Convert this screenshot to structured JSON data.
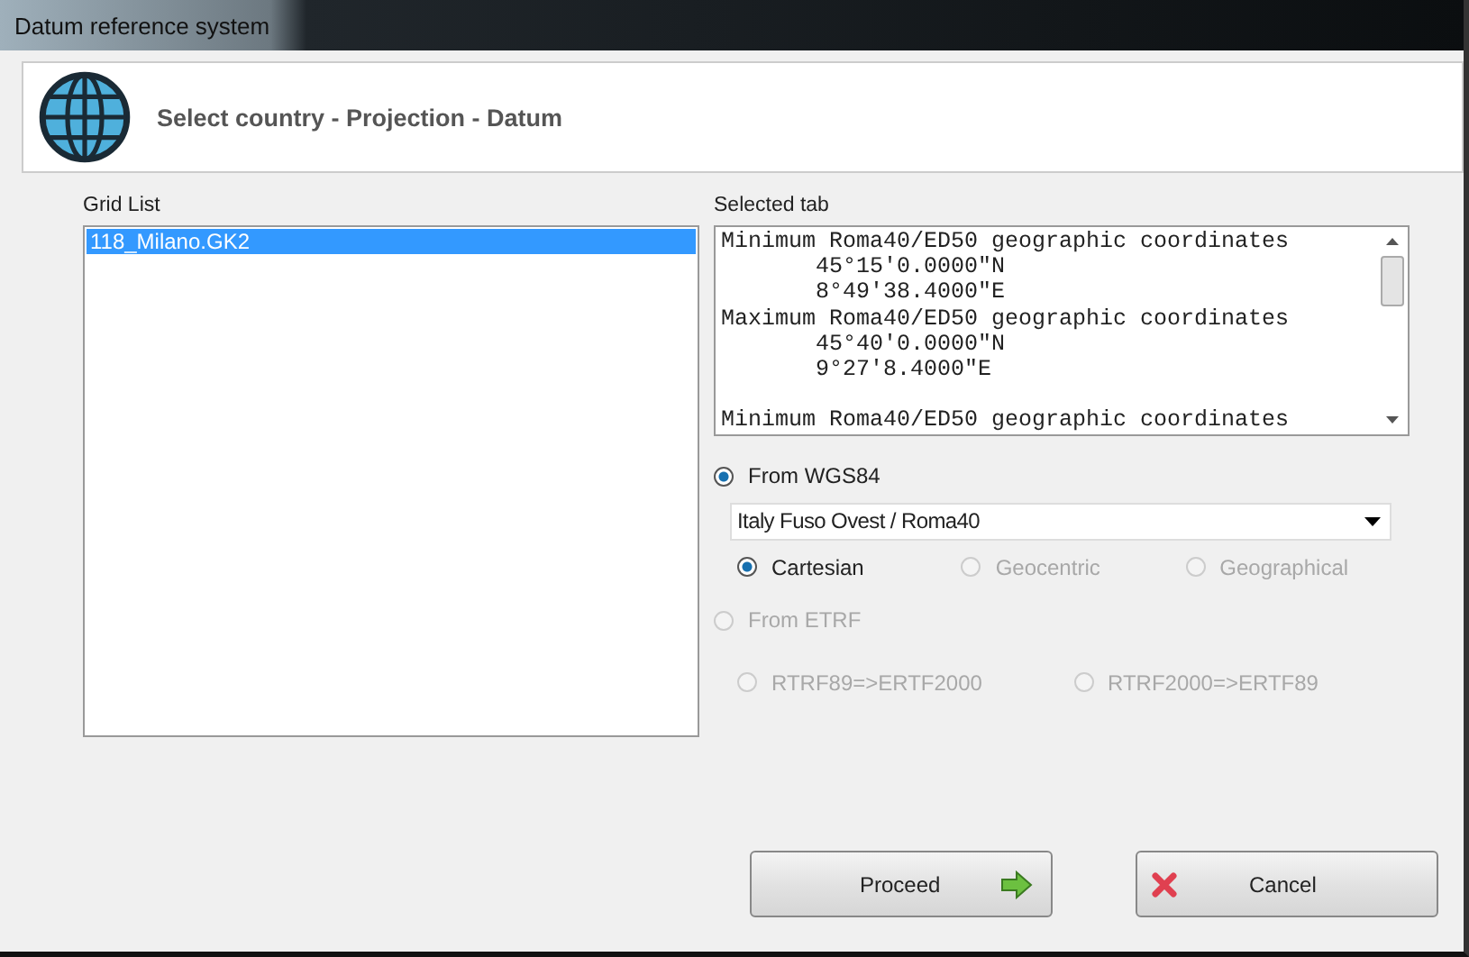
{
  "window": {
    "title": "Datum reference system"
  },
  "header": {
    "title": "Select country - Projection - Datum"
  },
  "grid_list": {
    "label": "Grid List",
    "items": [
      {
        "label": "118_Milano.GK2",
        "selected": true
      }
    ]
  },
  "selected_tab": {
    "label": "Selected tab",
    "text": "Minimum Roma40/ED50 geographic coordinates\n       45°15'0.0000\"N\n       8°49'38.4000\"E\nMaximum Roma40/ED50 geographic coordinates\n       45°40'0.0000\"N\n       9°27'8.4000\"E\n\nMinimum Roma40/ED50 geographic coordinates"
  },
  "from_wgs84": {
    "label": "From WGS84",
    "selected": true,
    "disabled": false,
    "dropdown": {
      "value": "Italy Fuso Ovest / Roma40"
    },
    "options": [
      {
        "label": "Cartesian",
        "selected": true,
        "disabled": false
      },
      {
        "label": "Geocentric",
        "selected": false,
        "disabled": true
      },
      {
        "label": "Geographical",
        "selected": false,
        "disabled": true
      }
    ]
  },
  "from_etrf": {
    "label": "From ETRF",
    "selected": false,
    "disabled": true,
    "options": [
      {
        "label": "RTRF89=>ERTF2000",
        "selected": false,
        "disabled": true
      },
      {
        "label": "RTRF2000=>ERTF89",
        "selected": false,
        "disabled": true
      }
    ]
  },
  "buttons": [
    {
      "label": "Proceed",
      "kind": "proceed"
    },
    {
      "label": "Cancel",
      "kind": "cancel"
    }
  ]
}
